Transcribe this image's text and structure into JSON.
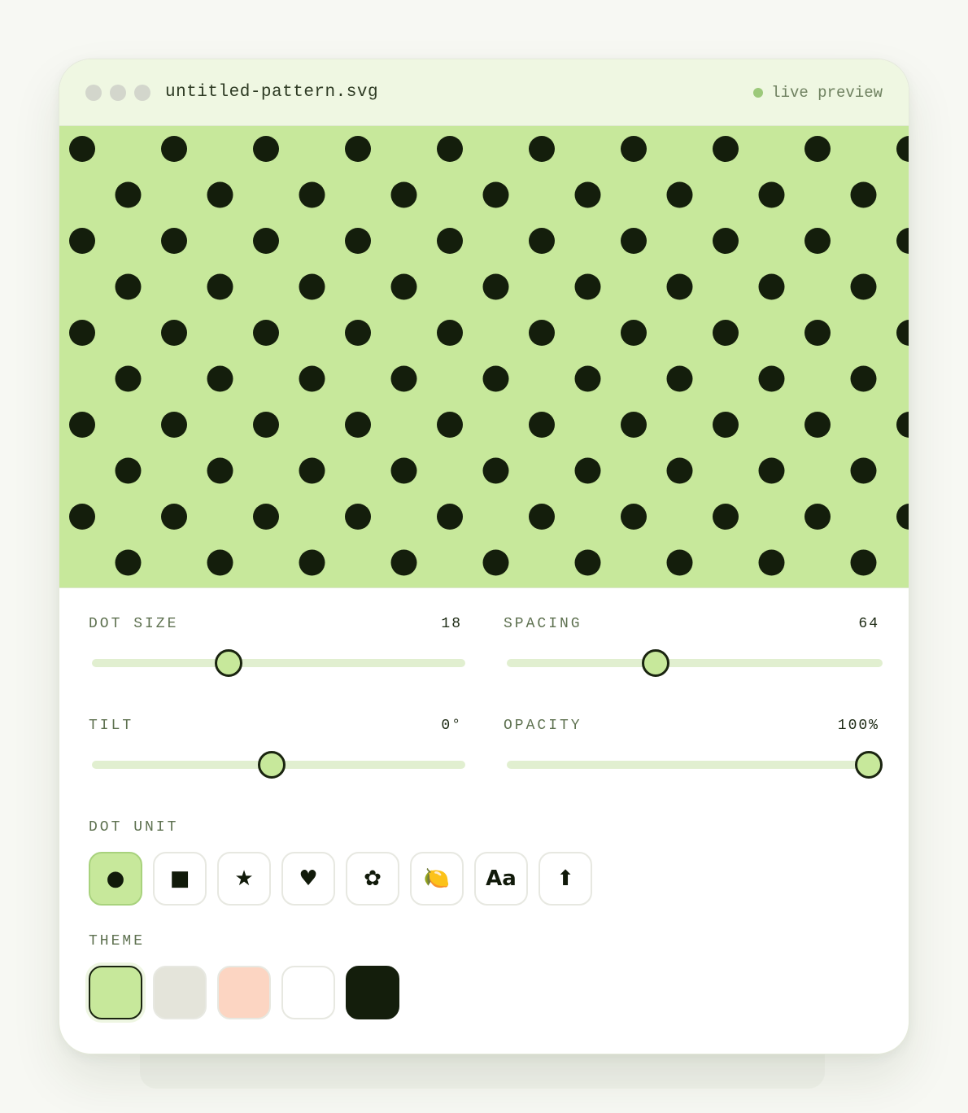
{
  "window": {
    "file_name": "untitled-pattern.svg",
    "status": "live preview",
    "status_color": "#9cc97a"
  },
  "pattern": {
    "background": "#c7e89b",
    "dot_color": "#141e0c",
    "layout": "staggered grid"
  },
  "sliders": [
    {
      "id": "dot-size",
      "label": "DOT SIZE",
      "value_text": "18",
      "fraction": 0.38
    },
    {
      "id": "spacing",
      "label": "SPACING",
      "value_text": "64",
      "fraction": 0.412
    },
    {
      "id": "tilt",
      "label": "TILT",
      "value_text": "0°",
      "fraction": 0.5
    },
    {
      "id": "opacity",
      "label": "OPACITY",
      "value_text": "100%",
      "fraction": 1.0
    }
  ],
  "dot_unit": {
    "label": "DOT UNIT",
    "options": [
      {
        "id": "circle",
        "glyph": "●",
        "icon": "circle-icon",
        "selected": true
      },
      {
        "id": "square",
        "glyph": "■",
        "icon": "square-icon",
        "selected": false
      },
      {
        "id": "star",
        "glyph": "★",
        "icon": "star-icon",
        "selected": false
      },
      {
        "id": "heart",
        "glyph": "♥",
        "icon": "heart-icon",
        "selected": false
      },
      {
        "id": "flower",
        "glyph": "✿",
        "icon": "flower-icon",
        "selected": false
      },
      {
        "id": "lemon",
        "glyph": "🍋",
        "icon": "lemon-icon",
        "selected": false
      },
      {
        "id": "text",
        "glyph": "Aa",
        "icon": "text-icon",
        "selected": false
      },
      {
        "id": "upload",
        "glyph": "⬆",
        "icon": "upload-icon",
        "selected": false
      }
    ]
  },
  "theme": {
    "label": "THEME",
    "swatches": [
      {
        "id": "green",
        "color": "#c7e89b",
        "selected": true
      },
      {
        "id": "stone",
        "color": "#e4e4da",
        "selected": false
      },
      {
        "id": "peach",
        "color": "#fcd5c2",
        "selected": false
      },
      {
        "id": "white",
        "color": "#ffffff",
        "selected": false
      },
      {
        "id": "ink",
        "color": "#141e0c",
        "selected": false
      }
    ]
  }
}
